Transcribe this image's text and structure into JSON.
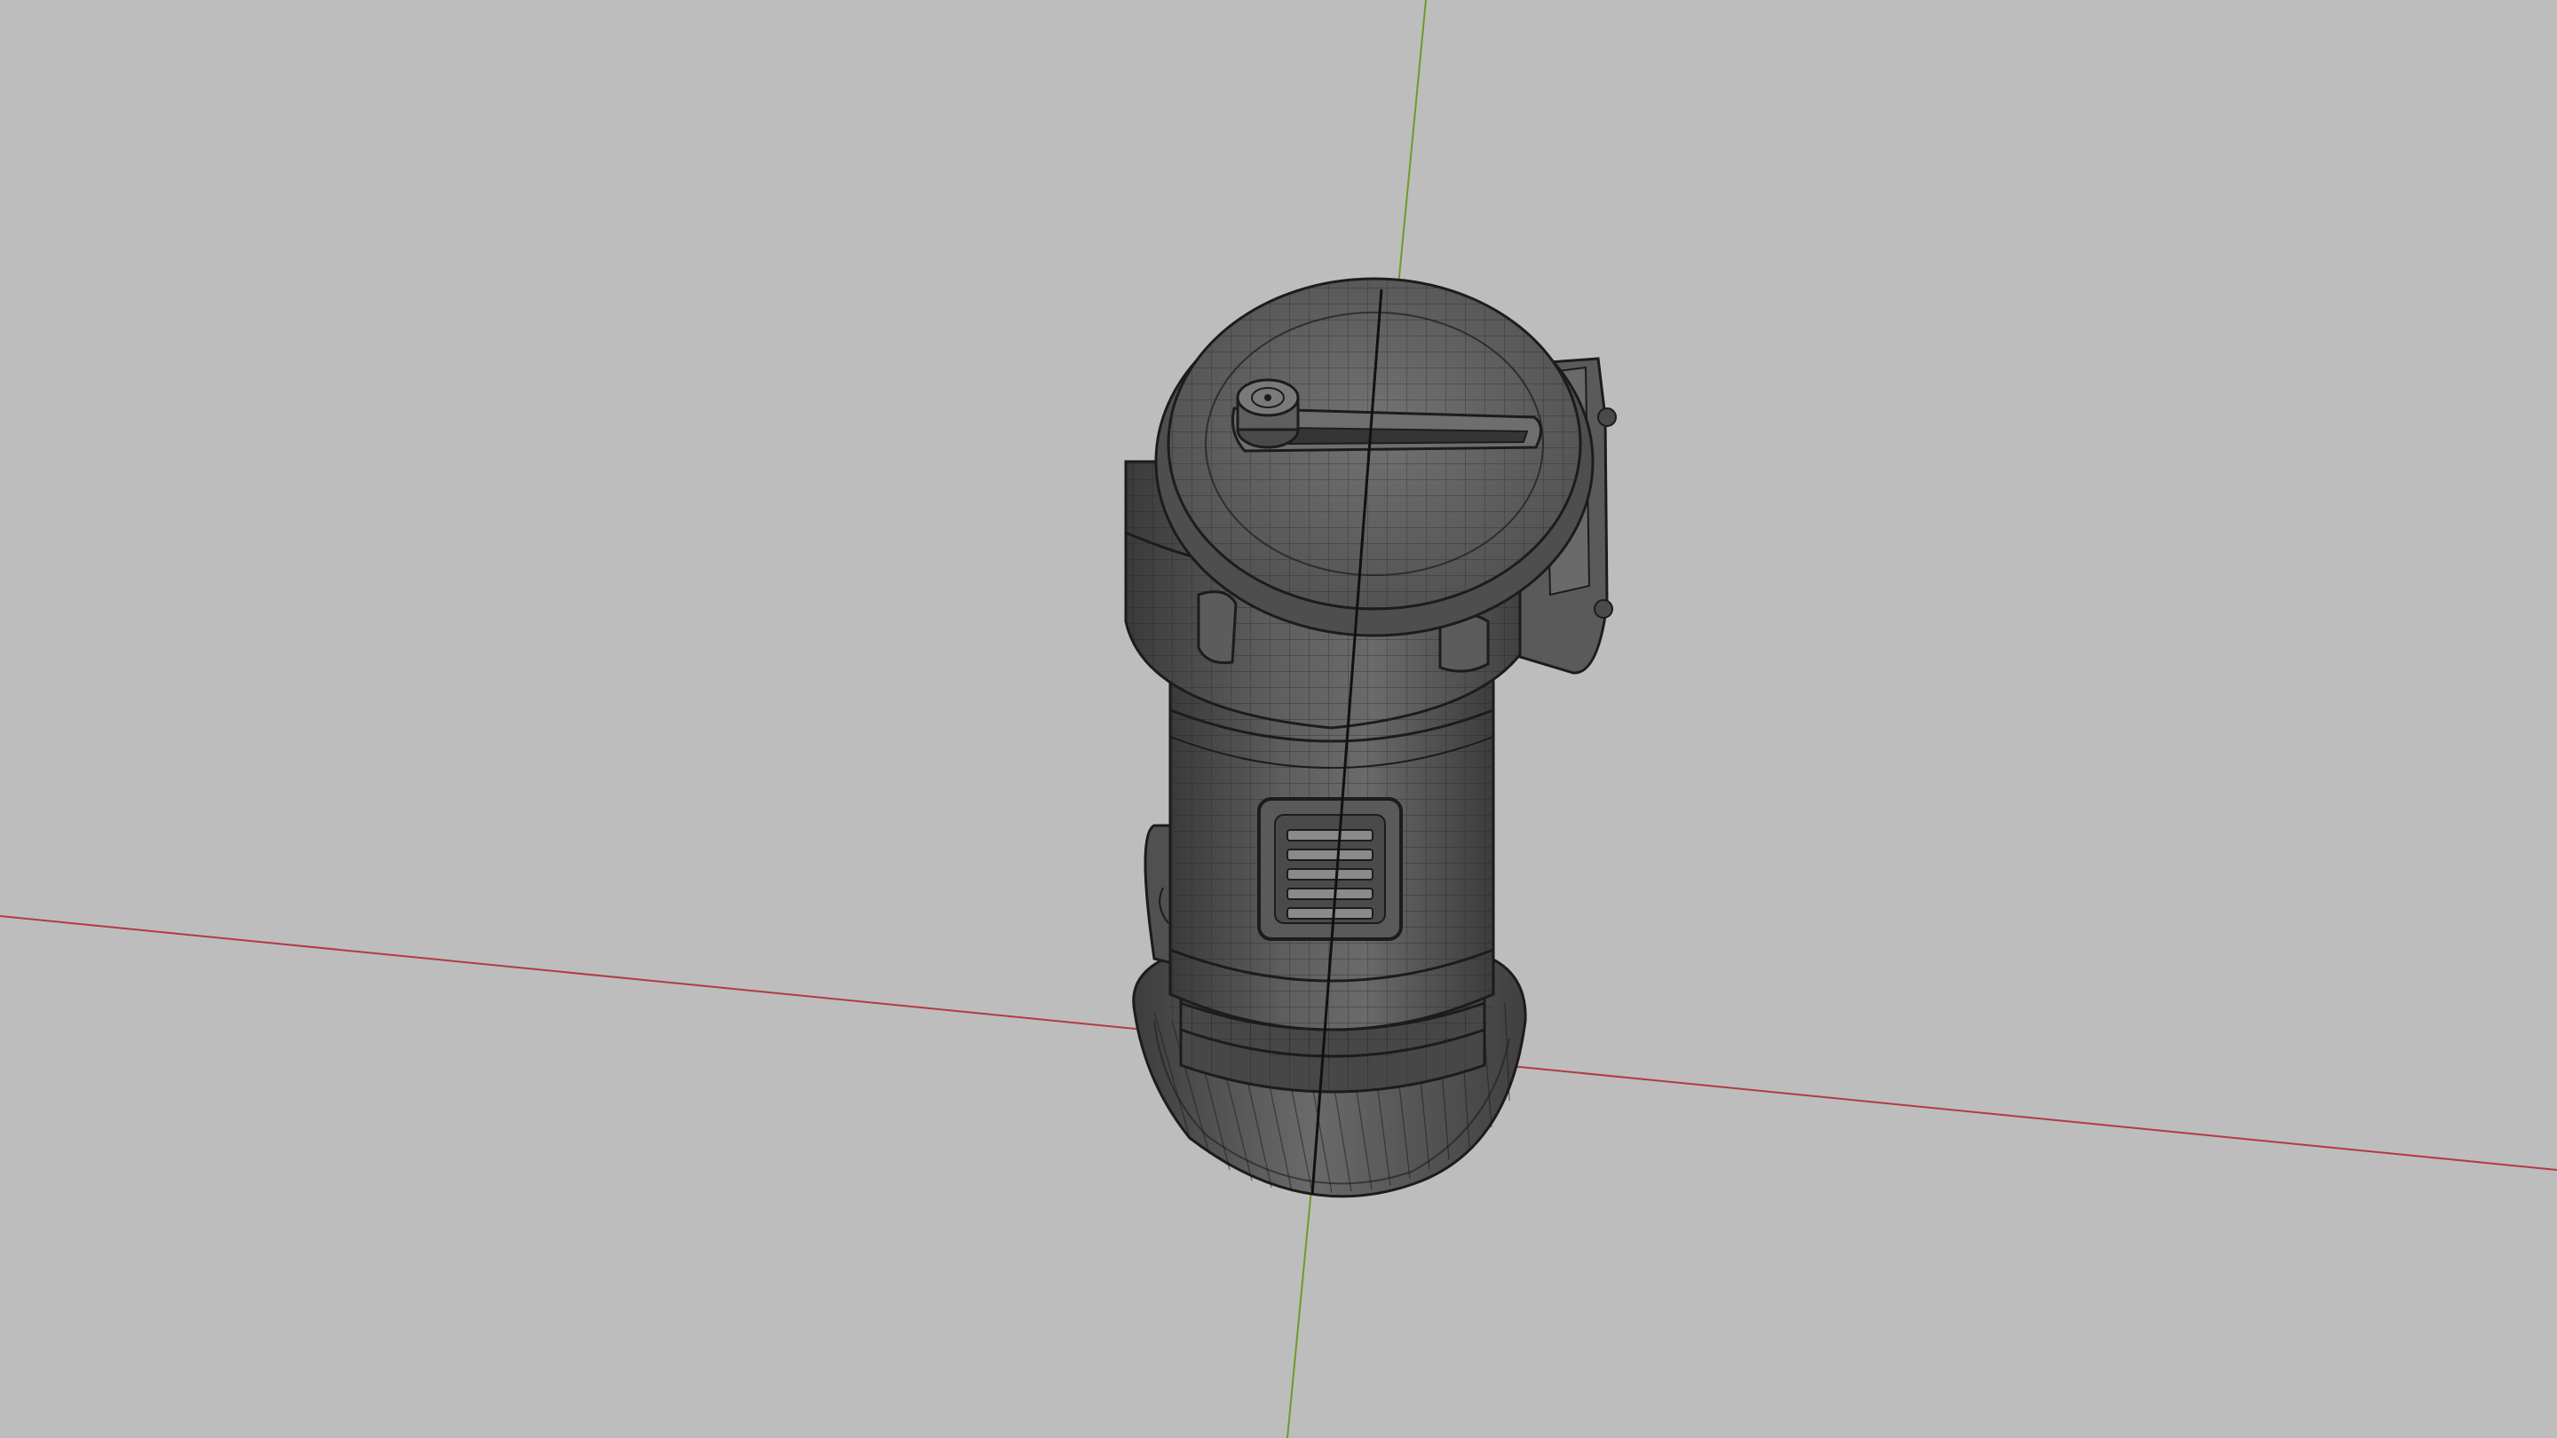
{
  "viewport": {
    "mode": "wireframe-overlay",
    "background_color": "#bdbdbd",
    "x_axis_color": "#b23a46",
    "y_axis_color": "#6f9a2a",
    "mesh_face_color": "#4a4a4a",
    "mesh_face_light_color": "#6b6b6b",
    "mesh_face_dark_color": "#2e2e2e",
    "wire_color": "#1c1c1c"
  },
  "model": {
    "object": "cylindrical-device",
    "parts": [
      "top-cap",
      "dial-knob",
      "top-slot",
      "side-bracket",
      "collar-tabs",
      "body-tube",
      "vent-panel",
      "base-rings",
      "flared-base"
    ]
  }
}
